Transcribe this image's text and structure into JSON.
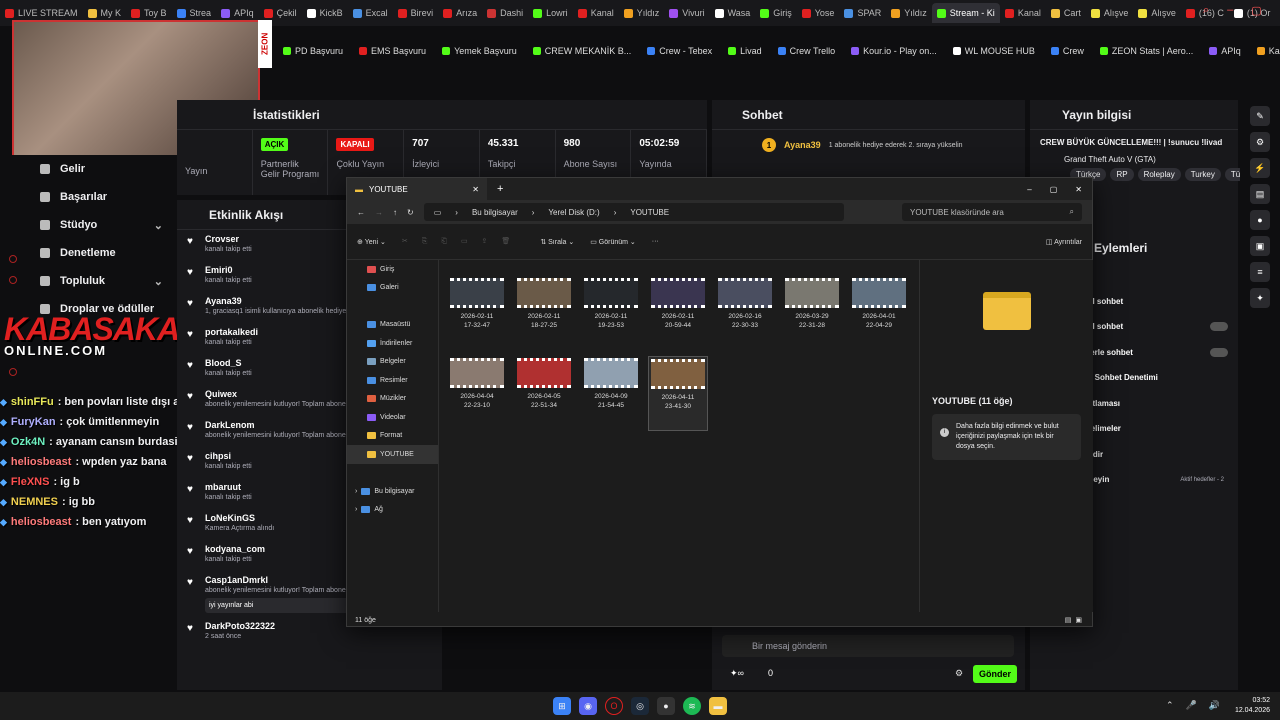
{
  "browser": {
    "tabs": [
      "LIVE STREAM",
      "My K",
      "Toy B",
      "Strea",
      "APIq",
      "Çekil",
      "KickB",
      "Excal",
      "Birevi",
      "Arıza",
      "Dashi",
      "Lowri",
      "Kanal",
      "Yıldız",
      "Vivuri",
      "Wasa",
      "Giriş",
      "Yose",
      "SPAR",
      "Yıldız",
      "Stream - Ki",
      "Kanal",
      "Cart",
      "Alışve",
      "Alışve",
      "(16) C",
      "(1) Or"
    ],
    "active_tab": "Stream - Ki",
    "bookmarks": [
      "PD Başvuru",
      "EMS Başvuru",
      "Yemek Başvuru",
      "CREW MEKANİK B...",
      "Crew - Tebex",
      "Livad",
      "Crew Trello",
      "Kour.io - Play on...",
      "WL MOUSE HUB",
      "Crew",
      "ZEON Stats | Aero...",
      "APIq",
      "Kampanyalar",
      "Streamer Panel"
    ]
  },
  "overlay": {
    "zeon": "ZEON",
    "logo": "KABASAKAL",
    "logo_sub": "ONLINE.COM"
  },
  "sidebar": {
    "items": [
      {
        "label": "Gelir"
      },
      {
        "label": "Başarılar"
      },
      {
        "label": "Stüdyo",
        "chev": "⌄"
      },
      {
        "label": "Denetleme"
      },
      {
        "label": "Topluluk",
        "chev": "⌄"
      },
      {
        "label": "Droplar ve ödüller"
      }
    ]
  },
  "chat": [
    {
      "user": "shinFFu",
      "color": "#e8e85a",
      "msg": ": ben povları liste dışı atıp sin oll arabi"
    },
    {
      "user": "FuryKan",
      "color": "#b0b0ff",
      "msg": ": çok ümitlenmeyin"
    },
    {
      "user": "Ozk4N",
      "color": "#6ef0c0",
      "msg": ": ayanam cansın burdasin"
    },
    {
      "user": "heliosbeast",
      "color": "#ff7b7b",
      "msg": ": wpden yaz bana"
    },
    {
      "user": "FleXNS",
      "color": "#ff5050",
      "msg": ": ig b"
    },
    {
      "user": "NEMNES",
      "color": "#f0d050",
      "msg": ": ig bb"
    },
    {
      "user": "heliosbeast",
      "color": "#ff7b7b",
      "msg": ": ben yatıyom"
    }
  ],
  "stats": {
    "title": "İstatistikleri",
    "items": [
      {
        "value": "",
        "label": "Yayın"
      },
      {
        "badge": "AÇIK",
        "badge_color": "#53fc18",
        "label": "Partnerlik Gelir Programı"
      },
      {
        "badge": "KAPALI",
        "badge_color": "#e91916",
        "label": "Çoklu Yayın"
      },
      {
        "value": "707",
        "label": "İzleyici"
      },
      {
        "value": "45.331",
        "label": "Takipçi"
      },
      {
        "value": "980",
        "label": "Abone Sayısı"
      },
      {
        "value": "05:02:59",
        "label": "Yayında"
      }
    ]
  },
  "activity": {
    "title": "Etkinlik Akışı",
    "items": [
      {
        "name": "Crovser",
        "sub": "kanalı takip etti"
      },
      {
        "name": "Emiri0",
        "sub": "kanalı takip etti"
      },
      {
        "name": "Ayana39",
        "sub": "1, graciasq1 isimli kullanıcıya abonelik hediye etti"
      },
      {
        "name": "portakalkedi",
        "sub": "kanalı takip etti"
      },
      {
        "name": "Blood_S",
        "sub": "kanalı takip etti"
      },
      {
        "name": "Quiwex",
        "sub": "abonelik yenilemesini kutluyor! Toplam abonelik süresi"
      },
      {
        "name": "DarkLenom",
        "sub": "abonelik yenilemesini kutluyor! Toplam abonelik süresi"
      },
      {
        "name": "cihpsi",
        "sub": "kanalı takip etti"
      },
      {
        "name": "mbaruut",
        "sub": "kanalı takip etti"
      },
      {
        "name": "LoNeKinGS",
        "sub": "Kamera Açtırma alındı"
      },
      {
        "name": "kodyana_com",
        "sub": "kanalı takip etti"
      },
      {
        "name": "Casp1anDmrkl",
        "sub": "abonelik yenilemesini kutluyor! Toplam abonelik süresi - 14 ay!",
        "box": "iyi yayınlar abi"
      },
      {
        "name": "DarkPoto322322",
        "sub": "2 saat önce"
      }
    ]
  },
  "sohbet": {
    "title": "Sohbet",
    "pinned_user": "Ayana39",
    "pinned_msg": "1 abonelik hediye ederek 2. sıraya yükselin",
    "input_placeholder": "Bir mesaj gönderin",
    "send": "Gönder",
    "count": "0"
  },
  "yayin": {
    "title": "Yayın bilgisi",
    "stream_title": "CREW BÜYÜK GÜNCELLEME!!! | !sunucu !livad",
    "game": "Grand Theft Auto V (GTA)",
    "tags": [
      "Türkçe",
      "RP",
      "Roleplay",
      "Turkey",
      "Tü"
    ],
    "actions_title": "Eylemleri",
    "actions": [
      "",
      "el sohbet",
      "el sohbet",
      "lerle sohbet",
      "e Sohbet Denetimi",
      "stlaması",
      "telimeler",
      "ndir",
      "rleyin"
    ],
    "aktif": "Aktif hedefler - 2"
  },
  "explorer": {
    "tab": "YOUTUBE",
    "path": [
      "Bu bilgisayar",
      "Yerel Disk (D:)",
      "YOUTUBE"
    ],
    "search": "YOUTUBE klasöründe ara",
    "cmd": [
      "Yeni",
      "Sırala",
      "Görünüm",
      "Ayrıntılar"
    ],
    "nav": [
      "Giriş",
      "Galeri",
      "",
      "Masaüstü",
      "İndirilenler",
      "Belgeler",
      "Resimler",
      "Müzikler",
      "Videolar",
      "Format",
      "YOUTUBE",
      "",
      "Bu bilgisayar",
      "Ağ"
    ],
    "files": [
      {
        "d": "2026-02-11",
        "t": "17-32-47",
        "c": "#3a4048"
      },
      {
        "d": "2026-02-11",
        "t": "18-27-25",
        "c": "#6a5a48"
      },
      {
        "d": "2026-02-11",
        "t": "19-23-53",
        "c": "#25282c"
      },
      {
        "d": "2026-02-11",
        "t": "20-59-44",
        "c": "#3a3550"
      },
      {
        "d": "2026-02-16",
        "t": "22-30-33",
        "c": "#4a4e60"
      },
      {
        "d": "2026-03-29",
        "t": "22-31-28",
        "c": "#7a7870"
      },
      {
        "d": "2026-04-01",
        "t": "22-04-29",
        "c": "#607080"
      },
      {
        "d": "2026-04-04",
        "t": "22-23-10",
        "c": "#8a7a70"
      },
      {
        "d": "2026-04-05",
        "t": "22-51-34",
        "c": "#b03030"
      },
      {
        "d": "2026-04-09",
        "t": "21-54-45",
        "c": "#90a0b0"
      },
      {
        "d": "2026-04-11",
        "t": "23-41-30",
        "c": "#806040"
      }
    ],
    "preview_title": "YOUTUBE (11 öğe)",
    "preview_info": "Daha fazla bilgi edinmek ve bulut içeriğinizi paylaşmak için tek bir dosya seçin.",
    "status": "11 öğe"
  },
  "taskbar": {
    "time": "03:52",
    "date": "12.04.2026"
  }
}
